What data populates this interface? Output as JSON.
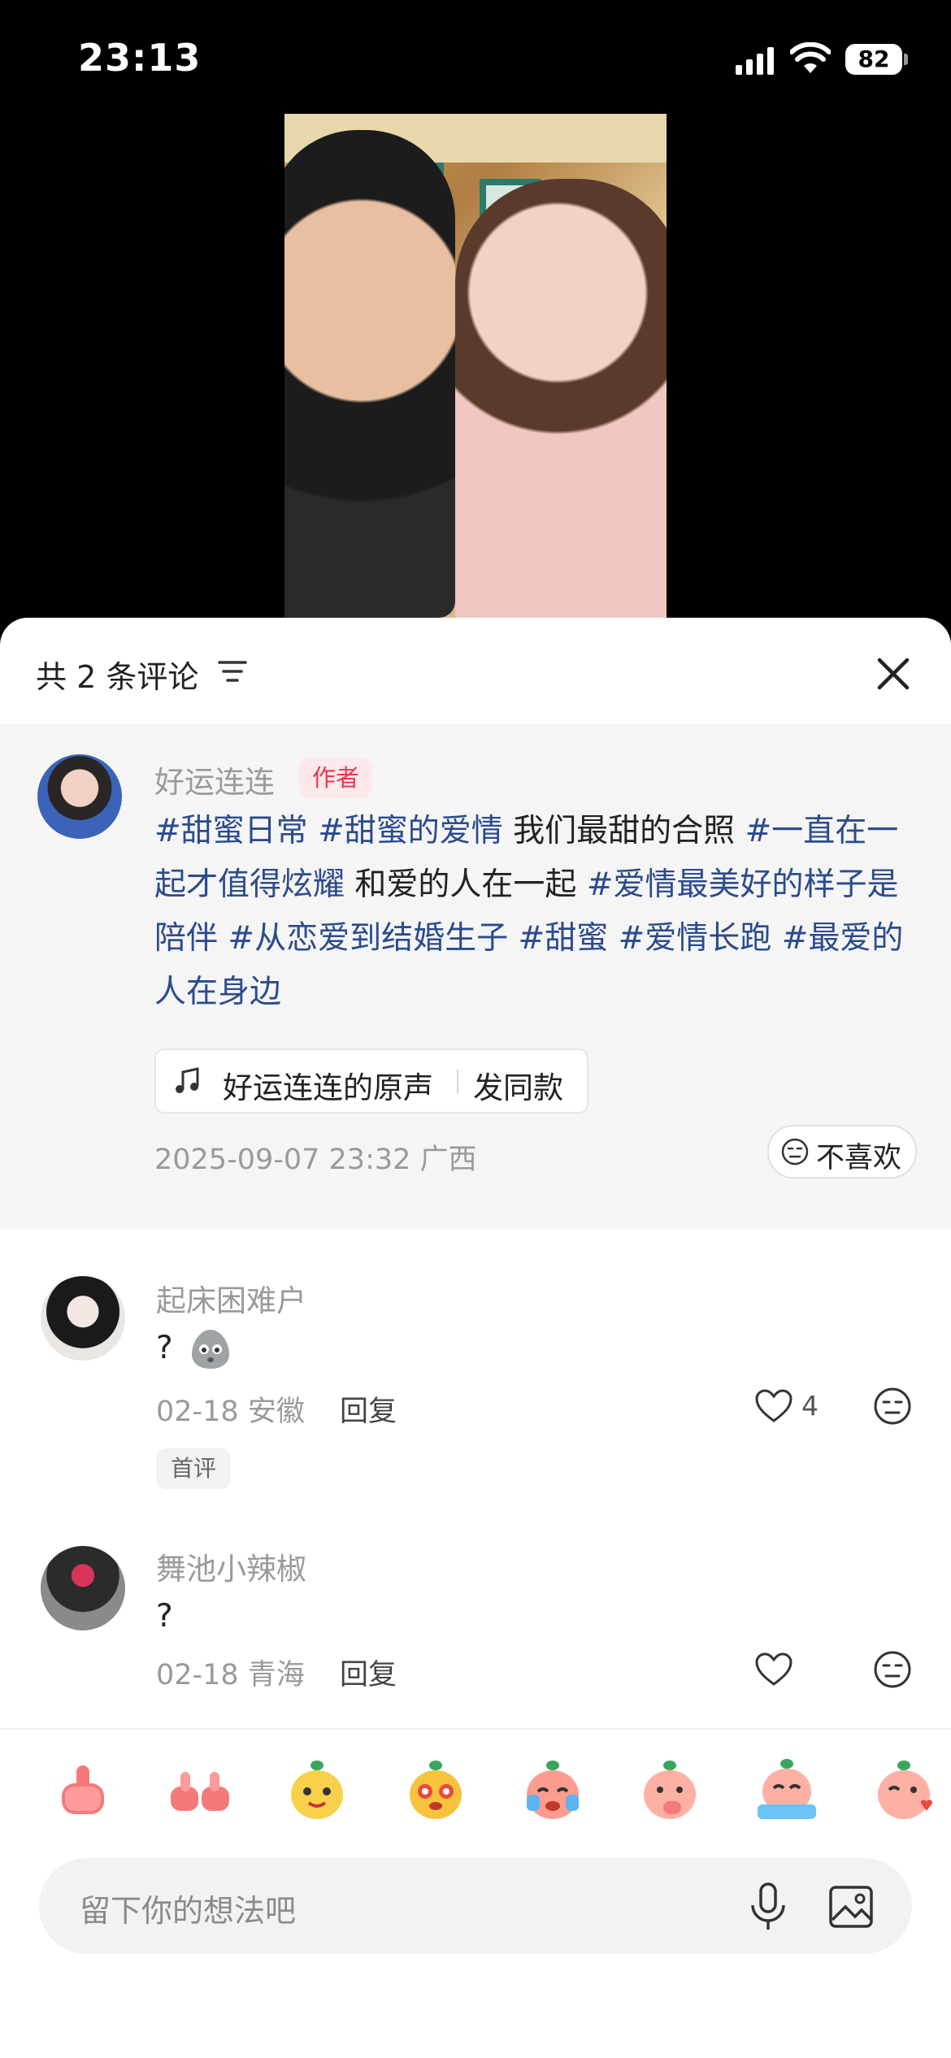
{
  "status_bar": {
    "time": "23:13",
    "battery": "82"
  },
  "comments_panel": {
    "title": "共 2 条评论",
    "author_post": {
      "name": "好运连连",
      "tag": "作者",
      "text_parts": [
        {
          "text": "#甜蜜日常",
          "hashtag": true
        },
        {
          "text": " ",
          "hashtag": false
        },
        {
          "text": "#甜蜜的爱情",
          "hashtag": true
        },
        {
          "text": " 我们最甜的合照 ",
          "hashtag": false
        },
        {
          "text": "#一直在一起才值得炫耀",
          "hashtag": true
        },
        {
          "text": " 和爱的人在一起 ",
          "hashtag": false
        },
        {
          "text": "#爱情最美好的样子是陪伴",
          "hashtag": true
        },
        {
          "text": " ",
          "hashtag": false
        },
        {
          "text": "#从恋爱到结婚生子",
          "hashtag": true
        },
        {
          "text": " ",
          "hashtag": false
        },
        {
          "text": "#甜蜜",
          "hashtag": true
        },
        {
          "text": " ",
          "hashtag": false
        },
        {
          "text": "#爱情长跑",
          "hashtag": true
        },
        {
          "text": " ",
          "hashtag": false
        },
        {
          "text": "#最爱的人在身边",
          "hashtag": true
        }
      ],
      "sound_name": "好运连连的原声",
      "sound_action": "发同款",
      "meta": "2025-09-07 23:32 广西",
      "dislike_label": "不喜欢"
    },
    "comments": [
      {
        "name": "起床困难户",
        "text": "?",
        "meta": "02-18 安徽",
        "reply": "回复",
        "likes": "4",
        "badge": "首评"
      },
      {
        "name": "舞池小辣椒",
        "text": "?",
        "meta": "02-18 青海",
        "reply": "回复"
      }
    ],
    "quick_emojis": [
      "thumbs-up",
      "double-thumbs-up",
      "happy-pear",
      "starry-eyes",
      "crying",
      "thinking",
      "crying-rain",
      "kiss"
    ],
    "input_placeholder": "留下你的想法吧"
  },
  "colors": {
    "hashtag": "#2b4b8c",
    "author_tag_text": "#f1334d",
    "author_tag_bg": "#fde9ea"
  }
}
